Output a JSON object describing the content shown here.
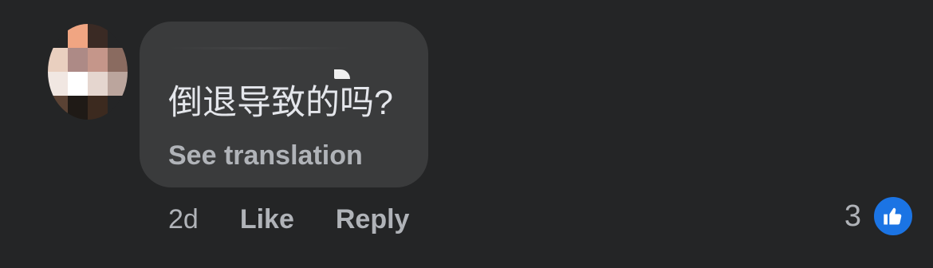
{
  "avatar": {
    "icon": "pixelated-profile-avatar",
    "pixels": [
      "#242526",
      "#f0a582",
      "#3a2a24",
      "#242526",
      "#e9cfbf",
      "#ad8a86",
      "#c5968a",
      "#8a6b60",
      "#f1e7e2",
      "#ffffff",
      "#e5d6cf",
      "#bba59d",
      "#5a4234",
      "#1f1a16",
      "#3c2a1f",
      "#242526"
    ]
  },
  "comment": {
    "text": "倒退导致的吗?",
    "translation_link": "See translation"
  },
  "actions": {
    "time": "2d",
    "like": "Like",
    "reply": "Reply"
  },
  "reactions": {
    "count": "3",
    "icon": "thumbs-up-icon",
    "color": "#1b74e4"
  },
  "colors": {
    "background": "#242526",
    "bubble": "#3a3b3c",
    "primary_text": "#e4e6eb",
    "secondary_text": "#b0b3b8"
  }
}
